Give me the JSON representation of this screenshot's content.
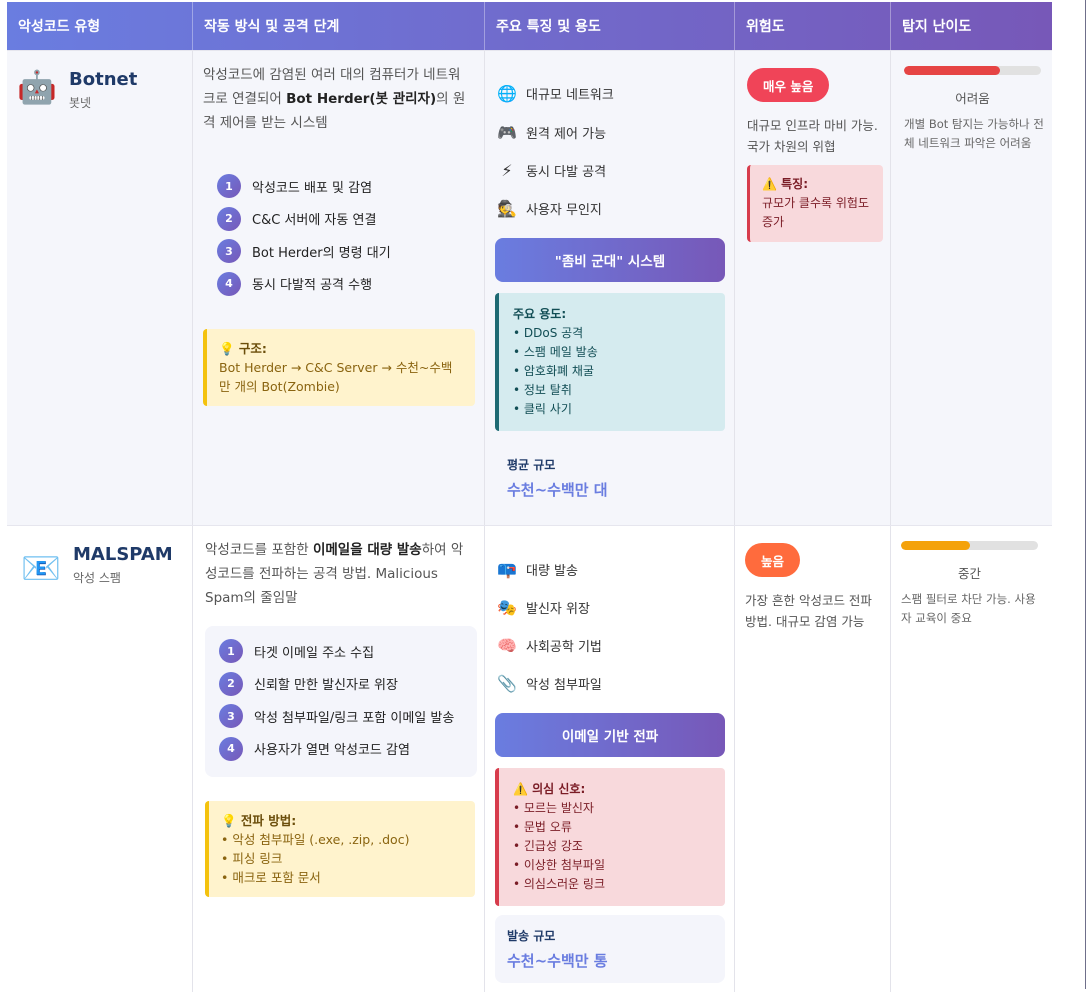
{
  "header": {
    "col1": "악성코드 유형",
    "col2": "작동 방식 및 공격 단계",
    "col3": "주요 특징 및 용도",
    "col4": "위험도",
    "col5": "탐지 난이도"
  },
  "colors": {
    "accent_start": "#6a7de0",
    "accent_end": "#7758b8",
    "danger": "#f04458",
    "high": "#ff6b3d",
    "bar_red": "#e64444",
    "bar_orange": "#f4a20b"
  },
  "rows": [
    {
      "icon": "robot-icon",
      "icon_glyph": "🤖",
      "name": "Botnet",
      "sub": "봇넷",
      "desc_pre": "악성코드에 감염된 여러 대의 컴퓨터가 네트워크로 연결되어 ",
      "desc_bold": "Bot Herder(봇 관리자)",
      "desc_post": "의 원격 제어를 받는 시스템",
      "steps": [
        "악성코드 배포 및 감염",
        "C&C 서버에 자동 연결",
        "Bot Herder의 명령 대기",
        "동시 다발적 공격 수행"
      ],
      "note_title": "💡 구조:",
      "note_lines": [
        "Bot Herder → C&C Server → 수천~수백만 개의 Bot(Zombie)"
      ],
      "features": [
        {
          "icon": "globe-icon",
          "glyph": "🌐",
          "label": "대규모 네트워크"
        },
        {
          "icon": "gamepad-icon",
          "glyph": "🎮",
          "label": "원격 제어 가능"
        },
        {
          "icon": "lightning-icon",
          "glyph": "⚡",
          "label": "동시 다발 공격"
        },
        {
          "icon": "spy-icon",
          "glyph": "🕵",
          "label": "사용자 무인지"
        }
      ],
      "pill": "\"좀비 군대\" 시스템",
      "box_title": "주요 용도:",
      "box_lines": [
        "• DDoS 공격",
        "• 스팸 메일 발송",
        "• 암호화폐 채굴",
        "• 정보 탈취",
        "• 클릭 사기"
      ],
      "scale_label": "평균 규모",
      "scale_value": "수천~수백만 대",
      "risk_badge": "매우 높음",
      "risk_desc": "대규모 인프라 마비 가능. 국가 차원의 위협",
      "risk_box_title": "⚠️ 특징:",
      "risk_box_text": "규모가 클수록 위험도 증가",
      "detect_level": 0.7,
      "detect_label": "어려움",
      "detect_desc": "개별 Bot 탐지는 가능하나 전체 네트워크 파악은 어려움"
    },
    {
      "icon": "email-icon",
      "icon_glyph": "📧",
      "name": "MALSPAM",
      "sub": "악성 스팸",
      "desc_pre": "악성코드를 포함한 ",
      "desc_bold": "이메일을 대량 발송",
      "desc_post": "하여 악성코드를 전파하는 공격 방법. Malicious Spam의 줄임말",
      "steps": [
        "타겟 이메일 주소 수집",
        "신뢰할 만한 발신자로 위장",
        "악성 첨부파일/링크 포함 이메일 발송",
        "사용자가 열면 악성코드 감염"
      ],
      "note_title": "💡 전파 방법:",
      "note_lines": [
        "• 악성 첨부파일 (.exe, .zip, .doc)",
        "• 피싱 링크",
        "• 매크로 포함 문서"
      ],
      "features": [
        {
          "icon": "mailbox-icon",
          "glyph": "📪",
          "label": "대량 발송"
        },
        {
          "icon": "mask-icon",
          "glyph": "🎭",
          "label": "발신자 위장"
        },
        {
          "icon": "brain-icon",
          "glyph": "🧠",
          "label": "사회공학 기법"
        },
        {
          "icon": "paperclip-icon",
          "glyph": "📎",
          "label": "악성 첨부파일"
        }
      ],
      "pill": "이메일 기반 전파",
      "box_title": "⚠️ 의심 신호:",
      "box_lines": [
        "• 모르는 발신자",
        "• 문법 오류",
        "• 긴급성 강조",
        "• 이상한 첨부파일",
        "• 의심스러운 링크"
      ],
      "scale_label": "발송 규모",
      "scale_value": "수천~수백만 통",
      "risk_badge": "높음",
      "risk_desc": "가장 흔한 악성코드 전파 방법. 대규모 감염 가능",
      "detect_level": 0.5,
      "detect_label": "중간",
      "detect_desc": "스팸 필터로 차단 가능. 사용자 교육이 중요"
    }
  ]
}
